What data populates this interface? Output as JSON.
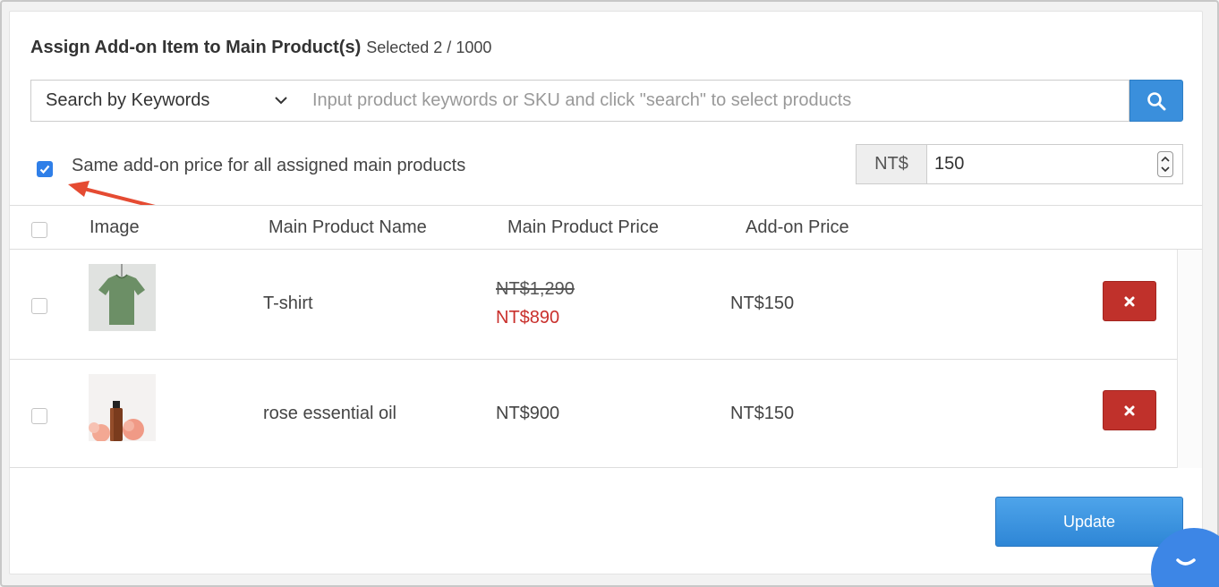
{
  "header": {
    "title": "Assign Add-on Item to Main Product(s)",
    "selected": "Selected 2 / 1000"
  },
  "search": {
    "mode_label": "Search by Keywords",
    "placeholder": "Input product keywords or SKU and click \"search\" to select products",
    "button_icon": "search-icon"
  },
  "same_price": {
    "checked": true,
    "label": "Same add-on price for all assigned main products",
    "currency": "NT$",
    "value": "150"
  },
  "table": {
    "columns": [
      "Image",
      "Main Product Name",
      "Main Product Price",
      "Add-on Price"
    ],
    "rows": [
      {
        "name": "T-shirt",
        "original_price": "NT$1,290",
        "sale_price": "NT$890",
        "addon_price": "NT$150"
      },
      {
        "name": "rose essential oil",
        "price": "NT$900",
        "addon_price": "NT$150"
      }
    ]
  },
  "footer": {
    "update_label": "Update"
  },
  "colors": {
    "primary": "#3a8fdc",
    "danger": "#c0312b",
    "sale": "#c9302c",
    "checkbox": "#2f7fe8",
    "annotation": "#e54b32"
  }
}
